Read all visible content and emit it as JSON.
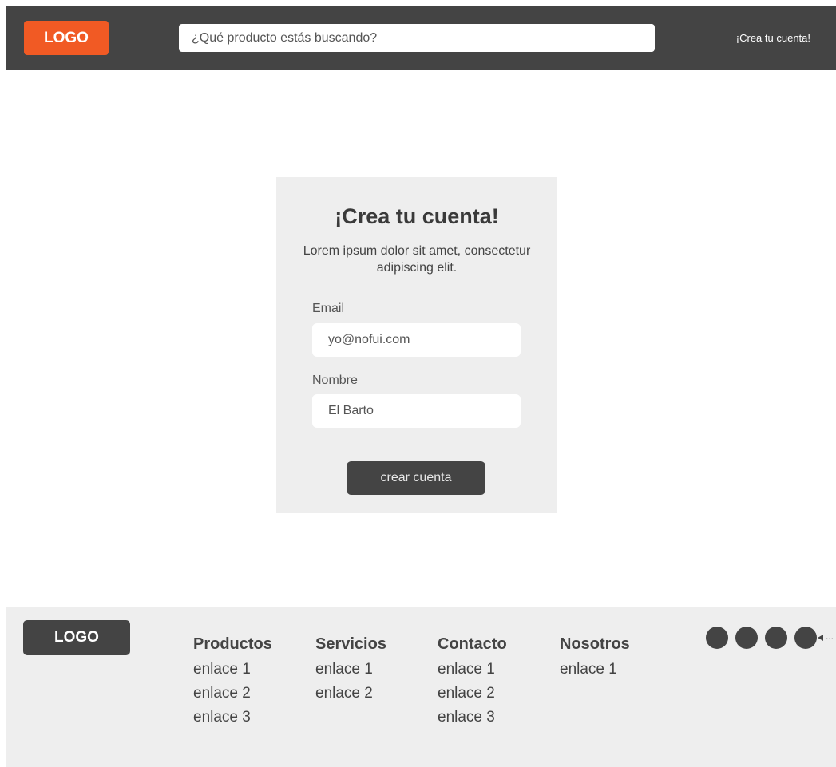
{
  "header": {
    "logo_label": "LOGO",
    "search_placeholder": "¿Qué producto estás buscando?",
    "signup_link": "¡Crea tu cuenta!"
  },
  "signup_card": {
    "title": "¡Crea tu cuenta!",
    "description": "Lorem ipsum dolor sit amet, consectetur adipiscing elit.",
    "email_label": "Email",
    "email_value": "yo@nofui.com",
    "name_label": "Nombre",
    "name_value": "El Barto",
    "submit_label": "crear cuenta"
  },
  "footer": {
    "logo_label": "LOGO",
    "columns": [
      {
        "title": "Productos",
        "links": [
          "enlace 1",
          "enlace 2",
          "enlace 3"
        ]
      },
      {
        "title": "Servicios",
        "links": [
          "enlace 1",
          "enlace 2"
        ]
      },
      {
        "title": "Contacto",
        "links": [
          "enlace 1",
          "enlace 2",
          "enlace 3"
        ]
      },
      {
        "title": "Nosotros",
        "links": [
          "enlace 1"
        ]
      }
    ],
    "social_icons": [
      "social-icon-1",
      "social-icon-2",
      "social-icon-3",
      "social-icon-4"
    ],
    "social_more": "..."
  },
  "colors": {
    "header_bg": "#444444",
    "brand_orange": "#f15a24",
    "card_bg": "#eeeeee",
    "footer_bg": "#eeeeee",
    "dark_button": "#444444"
  }
}
